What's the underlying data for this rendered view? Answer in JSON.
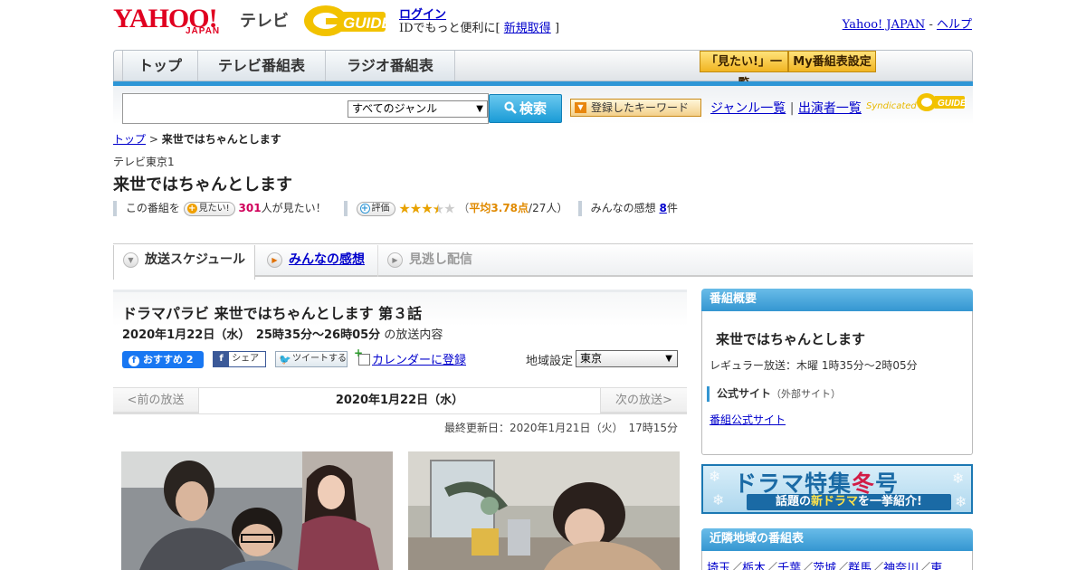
{
  "header": {
    "logo_yahoo": "YAHOO!",
    "logo_japan": "JAPAN",
    "logo_tv": "テレビ",
    "gguide_text": "GUIDE",
    "login": "ログイン",
    "id_prefix": "IDでもっと便利に[",
    "signup": "新規取得",
    "id_suffix": "]",
    "yahoo_japan_link": "Yahoo! JAPAN",
    "link_sep": "-",
    "help_link": "ヘルプ"
  },
  "nav": {
    "tabs": [
      {
        "label": "トップ"
      },
      {
        "label": "テレビ番組表"
      },
      {
        "label": "ラジオ番組表"
      }
    ],
    "mitai_list": "「見たい!」一覧",
    "my_schedule": "My番組表設定"
  },
  "search": {
    "genre_selected": "すべてのジャンル",
    "button": "検索",
    "keyword_button": "登録したキーワード",
    "genre_list": "ジャンル一覧",
    "divider": "|",
    "cast_list": "出演者一覧",
    "syndicated": "Syndicated"
  },
  "breadcrumb": {
    "top": "トップ",
    "sep": ">",
    "current": "来世ではちゃんとします"
  },
  "program": {
    "channel": "テレビ東京1",
    "title": "来世ではちゃんとします",
    "mitai_prefix": "この番組を",
    "mitai_pill": "見たい!",
    "mitai_count": "301",
    "mitai_suffix": "人が見たい！",
    "rating_pill": "評価",
    "rating_stars": 3.78,
    "rating_open": "（",
    "rating_avg": "平均3.78点",
    "rating_count": "/27人）",
    "impressions_prefix": "みんなの感想",
    "impressions_count": "8",
    "impressions_suffix": "件"
  },
  "tabs": {
    "schedule": "放送スケジュール",
    "impressions": "みんなの感想",
    "streaming": "見逃し配信"
  },
  "episode": {
    "title": "ドラマパラビ 来世ではちゃんとします 第３話",
    "date_bold": "2020年1月22日（水）　25時35分～26時05分",
    "date_suffix": "の放送内容",
    "fb_label": "おすすめ 2",
    "share_label": "シェア",
    "tweet_label": "ツイートする",
    "calendar_label": "カレンダーに登録",
    "region_label": "地域設定",
    "region_selected": "東京",
    "prev": "<前の放送",
    "current_date": "2020年1月22日（水）",
    "next": "次の放送>",
    "updated": "最終更新日：2020年1月21日（火）　17時15分"
  },
  "summary": {
    "header": "番組概要",
    "title": "来世ではちゃんとします",
    "regular": "レギュラー放送：木曜 1時35分～2時05分",
    "official_label": "公式サイト",
    "official_note": "（外部サイト）",
    "official_link": "番組公式サイト"
  },
  "banner": {
    "title_a": "ドラマ特集",
    "title_b": "冬",
    "title_c": "号",
    "sub_a": "話題の",
    "sub_b": "新ドラマ",
    "sub_c": "を一挙紹介!"
  },
  "nearby": {
    "header": "近隣地域の番組表",
    "links": [
      "埼玉",
      "栃木",
      "千葉",
      "茨城",
      "群馬",
      "神奈川",
      "東"
    ]
  },
  "colors": {
    "accent_blue": "#2e96d6",
    "yahoo_red": "#e00020",
    "link": "#0000cc",
    "star": "#e8a200",
    "mitai_count": "#d0005a"
  }
}
